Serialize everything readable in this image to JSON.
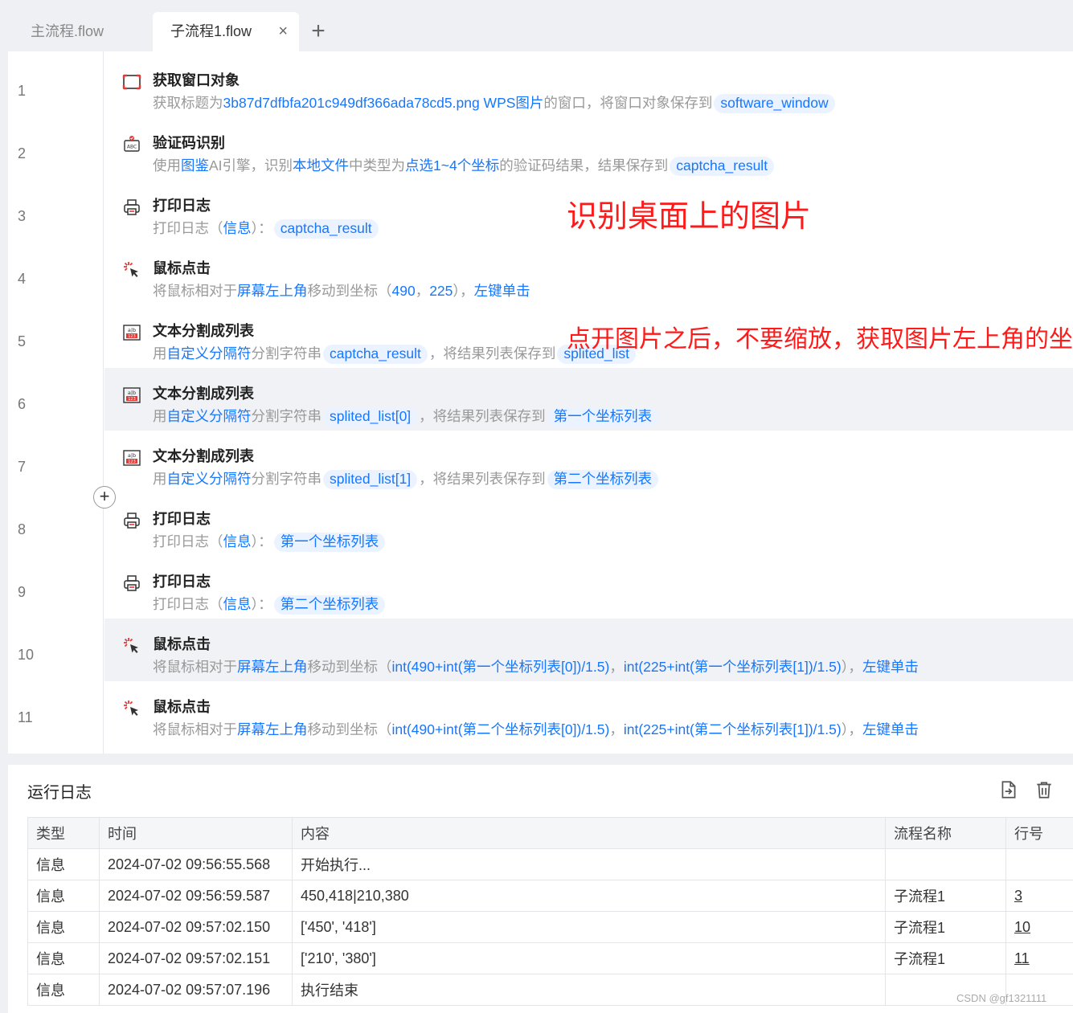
{
  "tabs": [
    {
      "label": "主流程.flow"
    },
    {
      "label": "子流程1.flow"
    }
  ],
  "icons": {
    "tab_close": "×",
    "tab_add": "+",
    "insert_step": "+"
  },
  "steps": [
    {
      "line": "1",
      "icon": "window-icon",
      "title": "获取窗口对象",
      "desc": [
        {
          "t": "获取标题为",
          "c": "p"
        },
        {
          "t": "3b87d7dfbfa201c949df366ada78cd5.png  WPS图片",
          "c": "k"
        },
        {
          "t": "的窗口，将窗口对象保存到",
          "c": "p"
        },
        {
          "t": "software_window",
          "c": "v"
        }
      ]
    },
    {
      "line": "2",
      "icon": "captcha-icon",
      "title": "验证码识别",
      "desc": [
        {
          "t": "使用",
          "c": "p"
        },
        {
          "t": "图鉴",
          "c": "k"
        },
        {
          "t": "AI引擎，识别",
          "c": "p"
        },
        {
          "t": "本地文件",
          "c": "k"
        },
        {
          "t": "中类型为",
          "c": "p"
        },
        {
          "t": "点选1~4个坐标",
          "c": "k"
        },
        {
          "t": "的验证码结果，结果保存到",
          "c": "p"
        },
        {
          "t": "captcha_result",
          "c": "v"
        }
      ]
    },
    {
      "line": "3",
      "icon": "printer-icon",
      "title": "打印日志",
      "desc": [
        {
          "t": "打印日志（",
          "c": "p"
        },
        {
          "t": "信息",
          "c": "k"
        },
        {
          "t": "）：",
          "c": "p"
        },
        {
          "t": "captcha_result",
          "c": "v"
        }
      ]
    },
    {
      "line": "4",
      "icon": "mouse-click-icon",
      "title": "鼠标点击",
      "desc": [
        {
          "t": "将鼠标相对于",
          "c": "p"
        },
        {
          "t": "屏幕左上角",
          "c": "k"
        },
        {
          "t": "移动到坐标（",
          "c": "p"
        },
        {
          "t": "490",
          "c": "k"
        },
        {
          "t": "，",
          "c": "p"
        },
        {
          "t": "225",
          "c": "k"
        },
        {
          "t": "），",
          "c": "p"
        },
        {
          "t": "左键单击",
          "c": "k"
        }
      ]
    },
    {
      "line": "5",
      "icon": "text-split-icon",
      "title": "文本分割成列表",
      "desc": [
        {
          "t": "用",
          "c": "p"
        },
        {
          "t": "自定义分隔符",
          "c": "k"
        },
        {
          "t": "分割字符串",
          "c": "p"
        },
        {
          "t": "captcha_result",
          "c": "v"
        },
        {
          "t": "，将结果列表保存到",
          "c": "p"
        },
        {
          "t": "splited_list",
          "c": "v"
        }
      ]
    },
    {
      "line": "6",
      "icon": "text-split-icon",
      "title": "文本分割成列表",
      "highlight": true,
      "desc": [
        {
          "t": "用",
          "c": "p"
        },
        {
          "t": "自定义分隔符",
          "c": "k"
        },
        {
          "t": "分割字符串",
          "c": "p"
        },
        {
          "t": "splited_list[0]",
          "c": "v"
        },
        {
          "t": "，将结果列表保存到",
          "c": "p"
        },
        {
          "t": "第一个坐标列表",
          "c": "v"
        }
      ]
    },
    {
      "line": "7",
      "icon": "text-split-icon",
      "title": "文本分割成列表",
      "desc": [
        {
          "t": "用",
          "c": "p"
        },
        {
          "t": "自定义分隔符",
          "c": "k"
        },
        {
          "t": "分割字符串",
          "c": "p"
        },
        {
          "t": "splited_list[1]",
          "c": "v"
        },
        {
          "t": "，将结果列表保存到",
          "c": "p"
        },
        {
          "t": "第二个坐标列表",
          "c": "v"
        }
      ]
    },
    {
      "line": "8",
      "icon": "printer-icon",
      "title": "打印日志",
      "desc": [
        {
          "t": "打印日志（",
          "c": "p"
        },
        {
          "t": "信息",
          "c": "k"
        },
        {
          "t": "）：",
          "c": "p"
        },
        {
          "t": "第一个坐标列表",
          "c": "v"
        }
      ]
    },
    {
      "line": "9",
      "icon": "printer-icon",
      "title": "打印日志",
      "desc": [
        {
          "t": "打印日志（",
          "c": "p"
        },
        {
          "t": "信息",
          "c": "k"
        },
        {
          "t": "）：",
          "c": "p"
        },
        {
          "t": "第二个坐标列表",
          "c": "v"
        }
      ]
    },
    {
      "line": "10",
      "icon": "mouse-click-icon",
      "title": "鼠标点击",
      "highlight": true,
      "desc": [
        {
          "t": "将鼠标相对于",
          "c": "p"
        },
        {
          "t": "屏幕左上角",
          "c": "k"
        },
        {
          "t": "移动到坐标（",
          "c": "p"
        },
        {
          "t": "int(490+int(第一个坐标列表[0])/1.5)",
          "c": "k"
        },
        {
          "t": "，",
          "c": "p"
        },
        {
          "t": "int(225+int(第一个坐标列表[1])/1.5)",
          "c": "k"
        },
        {
          "t": "），",
          "c": "p"
        },
        {
          "t": "左键单击",
          "c": "k"
        }
      ]
    },
    {
      "line": "11",
      "icon": "mouse-click-icon",
      "title": "鼠标点击",
      "desc": [
        {
          "t": "将鼠标相对于",
          "c": "p"
        },
        {
          "t": "屏幕左上角",
          "c": "k"
        },
        {
          "t": "移动到坐标（",
          "c": "p"
        },
        {
          "t": "int(490+int(第二个坐标列表[0])/1.5)",
          "c": "k"
        },
        {
          "t": "，",
          "c": "p"
        },
        {
          "t": "int(225+int(第二个坐标列表[1])/1.5)",
          "c": "k"
        },
        {
          "t": "），",
          "c": "p"
        },
        {
          "t": "左键单击",
          "c": "k"
        }
      ]
    }
  ],
  "annotations": {
    "a1": "识别桌面上的图片",
    "a2": "点开图片之后，不要缩放，获取图片左上角的坐标"
  },
  "log": {
    "title": "运行日志",
    "columns": [
      "类型",
      "时间",
      "内容",
      "流程名称",
      "行号"
    ],
    "rows": [
      [
        "信息",
        "2024-07-02 09:56:55.568",
        "开始执行...",
        "",
        ""
      ],
      [
        "信息",
        "2024-07-02 09:56:59.587",
        "450,418|210,380",
        "子流程1",
        "3"
      ],
      [
        "信息",
        "2024-07-02 09:57:02.150",
        "['450', '418']",
        "子流程1",
        "10"
      ],
      [
        "信息",
        "2024-07-02 09:57:02.151",
        "['210', '380']",
        "子流程1",
        "11"
      ],
      [
        "信息",
        "2024-07-02 09:57:07.196",
        "执行结束",
        "",
        ""
      ]
    ]
  },
  "watermark": "CSDN @gf1321111",
  "colors": {
    "link": "#1677ff",
    "annotation": "#ff1a1a",
    "row_highlight": "#f1f2f5"
  }
}
